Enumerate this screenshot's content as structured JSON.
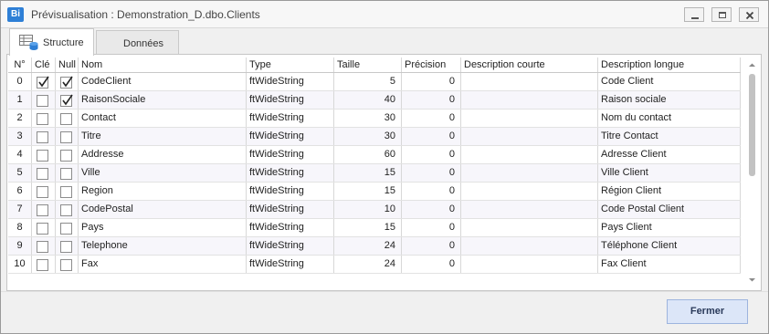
{
  "window": {
    "app_logo": "Bi",
    "title": "Prévisualisation : Demonstration_D.dbo.Clients"
  },
  "tabs": [
    {
      "label": "Structure",
      "icon": "table-database-icon",
      "active": true
    },
    {
      "label": "Données",
      "active": false
    }
  ],
  "table": {
    "columns": [
      "N°",
      "Clé",
      "Null",
      "Nom",
      "Type",
      "Taille",
      "Précision",
      "Description courte",
      "Description longue"
    ],
    "rows": [
      {
        "n": "0",
        "key": true,
        "null": true,
        "nom": "CodeClient",
        "type": "ftWideString",
        "taille": "5",
        "precision": "0",
        "desc_courte": "",
        "desc_longue": "Code Client"
      },
      {
        "n": "1",
        "key": false,
        "null": true,
        "nom": "RaisonSociale",
        "type": "ftWideString",
        "taille": "40",
        "precision": "0",
        "desc_courte": "",
        "desc_longue": "Raison sociale"
      },
      {
        "n": "2",
        "key": false,
        "null": false,
        "nom": "Contact",
        "type": "ftWideString",
        "taille": "30",
        "precision": "0",
        "desc_courte": "",
        "desc_longue": "Nom du contact"
      },
      {
        "n": "3",
        "key": false,
        "null": false,
        "nom": "Titre",
        "type": "ftWideString",
        "taille": "30",
        "precision": "0",
        "desc_courte": "",
        "desc_longue": "Titre Contact"
      },
      {
        "n": "4",
        "key": false,
        "null": false,
        "nom": "Addresse",
        "type": "ftWideString",
        "taille": "60",
        "precision": "0",
        "desc_courte": "",
        "desc_longue": "Adresse Client"
      },
      {
        "n": "5",
        "key": false,
        "null": false,
        "nom": "Ville",
        "type": "ftWideString",
        "taille": "15",
        "precision": "0",
        "desc_courte": "",
        "desc_longue": "Ville Client"
      },
      {
        "n": "6",
        "key": false,
        "null": false,
        "nom": "Region",
        "type": "ftWideString",
        "taille": "15",
        "precision": "0",
        "desc_courte": "",
        "desc_longue": "Région Client"
      },
      {
        "n": "7",
        "key": false,
        "null": false,
        "nom": "CodePostal",
        "type": "ftWideString",
        "taille": "10",
        "precision": "0",
        "desc_courte": "",
        "desc_longue": "Code Postal Client"
      },
      {
        "n": "8",
        "key": false,
        "null": false,
        "nom": "Pays",
        "type": "ftWideString",
        "taille": "15",
        "precision": "0",
        "desc_courte": "",
        "desc_longue": "Pays Client"
      },
      {
        "n": "9",
        "key": false,
        "null": false,
        "nom": "Telephone",
        "type": "ftWideString",
        "taille": "24",
        "precision": "0",
        "desc_courte": "",
        "desc_longue": "Téléphone Client"
      },
      {
        "n": "10",
        "key": false,
        "null": false,
        "nom": "Fax",
        "type": "ftWideString",
        "taille": "24",
        "precision": "0",
        "desc_courte": "",
        "desc_longue": "Fax Client"
      }
    ]
  },
  "footer": {
    "close_label": "Fermer"
  },
  "colors": {
    "accent": "#2e7fd6",
    "button_bg": "#dce6f8",
    "alt_row": "#f7f6fb"
  }
}
